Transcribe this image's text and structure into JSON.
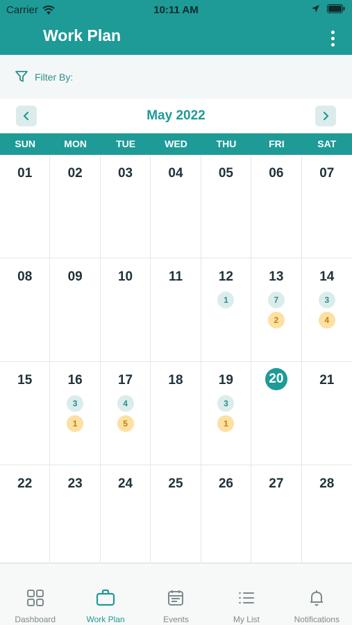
{
  "status_bar": {
    "carrier": "Carrier",
    "time": "10:11 AM"
  },
  "header": {
    "title": "Work Plan"
  },
  "filter": {
    "label": "Filter By:"
  },
  "month_nav": {
    "month": "May 2022"
  },
  "weekdays": [
    "SUN",
    "MON",
    "TUE",
    "WED",
    "THU",
    "FRI",
    "SAT"
  ],
  "weeks": [
    [
      {
        "day": "01"
      },
      {
        "day": "02"
      },
      {
        "day": "03"
      },
      {
        "day": "04"
      },
      {
        "day": "05"
      },
      {
        "day": "06"
      },
      {
        "day": "07"
      }
    ],
    [
      {
        "day": "08"
      },
      {
        "day": "09"
      },
      {
        "day": "10"
      },
      {
        "day": "11"
      },
      {
        "day": "12",
        "teal": "1"
      },
      {
        "day": "13",
        "teal": "7",
        "yellow": "2"
      },
      {
        "day": "14",
        "teal": "3",
        "yellow": "4"
      }
    ],
    [
      {
        "day": "15"
      },
      {
        "day": "16",
        "teal": "3",
        "yellow": "1"
      },
      {
        "day": "17",
        "teal": "4",
        "yellow": "5"
      },
      {
        "day": "18"
      },
      {
        "day": "19",
        "teal": "3",
        "yellow": "1"
      },
      {
        "day": "20",
        "today": true
      },
      {
        "day": "21"
      }
    ],
    [
      {
        "day": "22"
      },
      {
        "day": "23"
      },
      {
        "day": "24"
      },
      {
        "day": "25"
      },
      {
        "day": "26"
      },
      {
        "day": "27"
      },
      {
        "day": "28"
      }
    ]
  ],
  "tabs": [
    {
      "label": "Dashboard",
      "icon": "grid-icon",
      "active": false
    },
    {
      "label": "Work Plan",
      "icon": "briefcase-icon",
      "active": true
    },
    {
      "label": "Events",
      "icon": "calendar-icon",
      "active": false
    },
    {
      "label": "My List",
      "icon": "list-icon",
      "active": false
    },
    {
      "label": "Notifications",
      "icon": "bell-icon",
      "active": false
    }
  ],
  "colors": {
    "accent": "#1e9a97",
    "badge_teal": "#dcecec",
    "badge_yellow": "#fde0a2"
  }
}
